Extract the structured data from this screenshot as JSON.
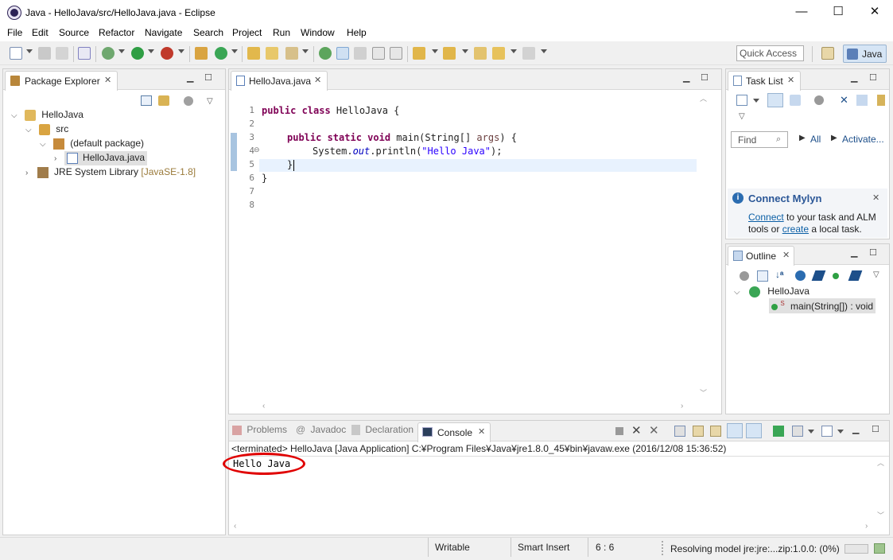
{
  "window": {
    "title": "Java - HelloJava/src/HelloJava.java - Eclipse",
    "minimize": "—",
    "maximize": "☐",
    "close": "✕"
  },
  "menubar": [
    "File",
    "Edit",
    "Source",
    "Refactor",
    "Navigate",
    "Search",
    "Project",
    "Run",
    "Window",
    "Help"
  ],
  "toolbar": {
    "quick_access_placeholder": "Quick Access",
    "perspective_label": "Java"
  },
  "package_explorer": {
    "tab_label": "Package Explorer",
    "tree": {
      "project": "HelloJava",
      "src": "src",
      "package": "(default package)",
      "file": "HelloJava.java",
      "library": "JRE System Library",
      "library_suffix": "[JavaSE-1.8]"
    }
  },
  "editor": {
    "tab_label": "HelloJava.java",
    "line_numbers": [
      "1",
      "2",
      "3",
      "4",
      "5",
      "6",
      "7",
      "8"
    ],
    "lines": {
      "l2_kw": "public class",
      "l2_rest": " HelloJava {",
      "l4_kw": "public static void",
      "l4_rest": " main(String[] ",
      "l4_args": "args",
      "l4_end": ") {",
      "l5_pre": "System.",
      "l5_out": "out",
      "l5_mid": ".println(",
      "l5_str": "\"Hello Java\"",
      "l5_end": ");",
      "l6": "}",
      "l7": "}"
    }
  },
  "task_list": {
    "tab_label": "Task List",
    "find_placeholder": "Find",
    "all_label": "All",
    "activate_label": "Activate...",
    "mylyn_title": "Connect Mylyn",
    "mylyn_connect": "Connect",
    "mylyn_text1": " to your task and ALM",
    "mylyn_text2": "tools or ",
    "mylyn_create": "create",
    "mylyn_text3": " a local task."
  },
  "outline": {
    "tab_label": "Outline",
    "class_name": "HelloJava",
    "method": "main(String[]) : void",
    "static_marker": "S"
  },
  "bottom": {
    "tabs": [
      "Problems",
      "Javadoc",
      "Declaration",
      "Console"
    ],
    "console_header": "<terminated> HelloJava [Java Application] C:¥Program Files¥Java¥jre1.8.0_45¥bin¥javaw.exe (2016/12/08 15:36:52)",
    "console_output": "Hello Java"
  },
  "status": {
    "writable": "Writable",
    "insert_mode": "Smart Insert",
    "position": "6 : 6",
    "progress_text": "Resolving model jre:jre:...zip:1.0.0: (0%)"
  },
  "colors": {
    "annotation": "#e00000",
    "keyword": "#7f0055",
    "string": "#2a00ff",
    "link": "#0b5fa5"
  }
}
